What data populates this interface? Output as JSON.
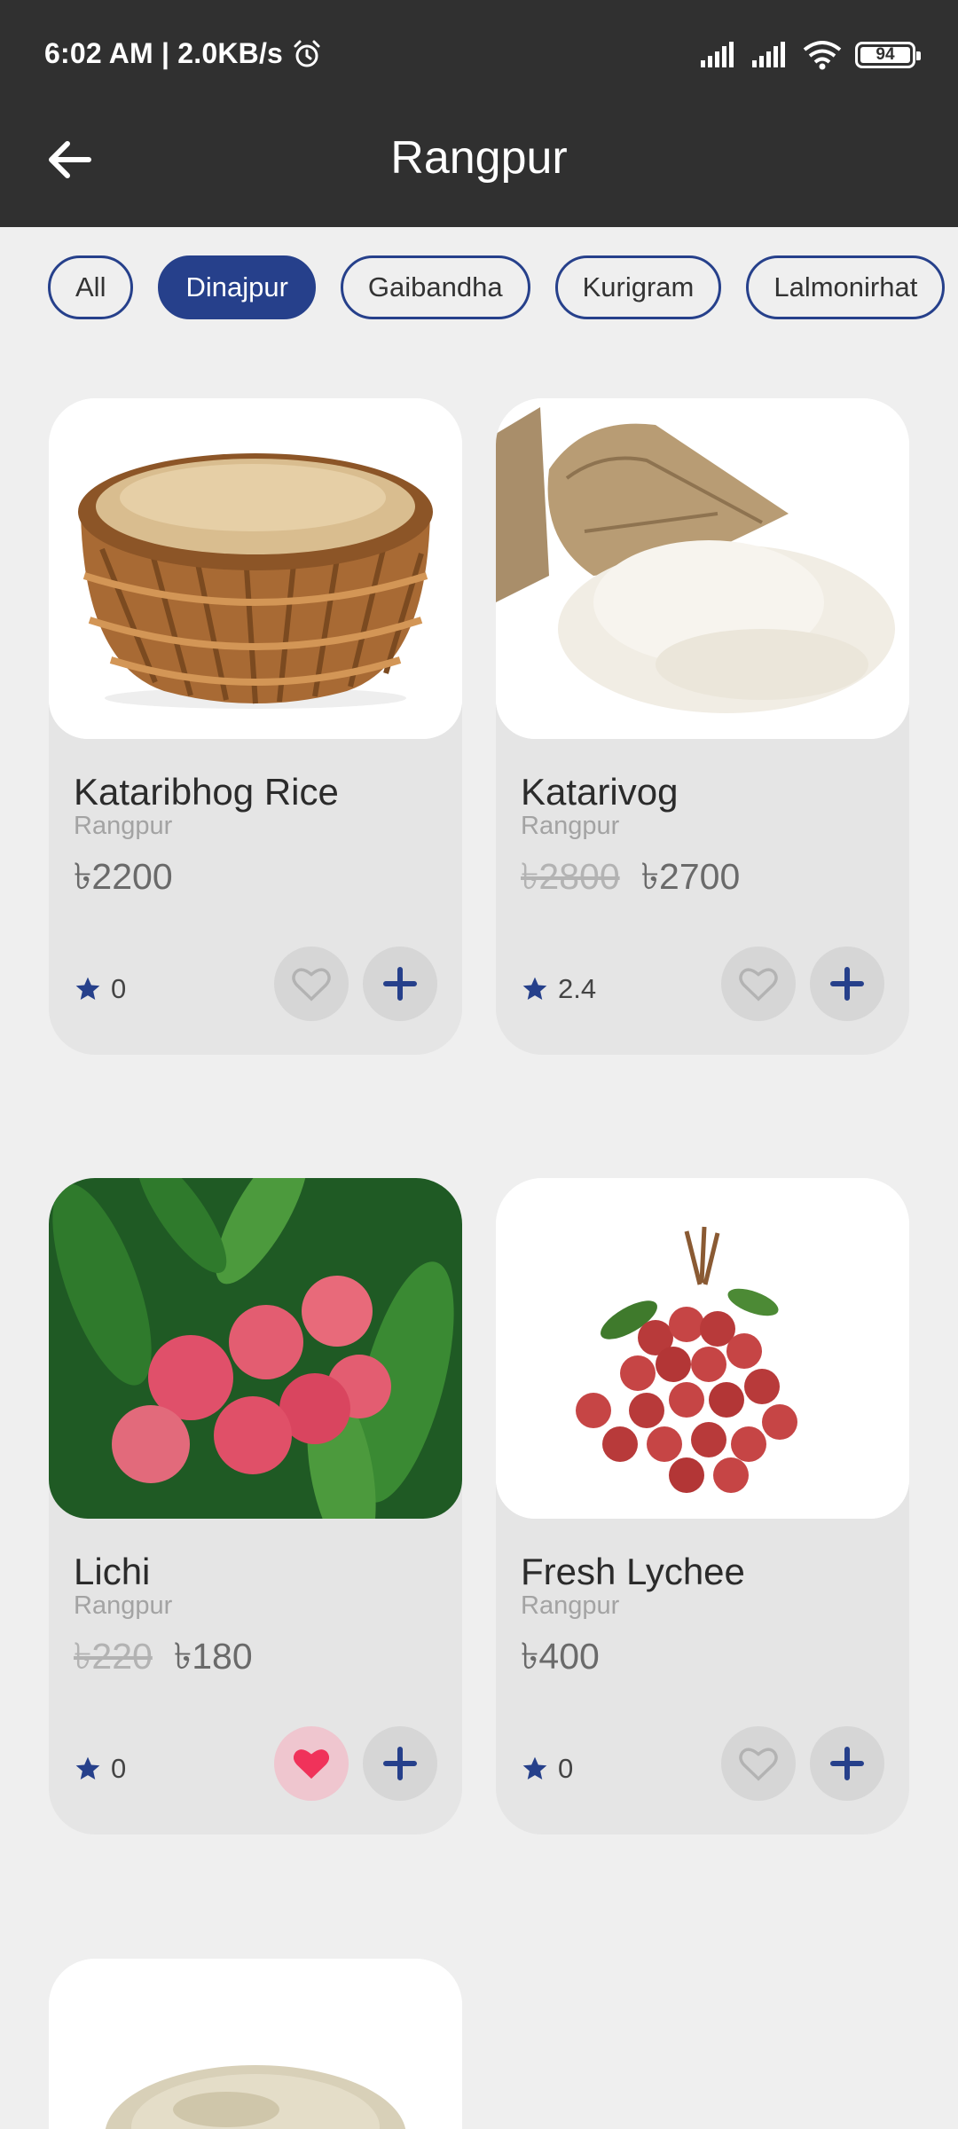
{
  "status_bar": {
    "time_speed": "6:02 AM | 2.0KB/s",
    "battery": "94"
  },
  "app_bar": {
    "title": "Rangpur"
  },
  "filters": [
    {
      "label": "All",
      "active": false
    },
    {
      "label": "Dinajpur",
      "active": true
    },
    {
      "label": "Gaibandha",
      "active": false
    },
    {
      "label": "Kurigram",
      "active": false
    },
    {
      "label": "Lalmonirhat",
      "active": false
    }
  ],
  "products": [
    {
      "name": "Kataribhog Rice",
      "location": "Rangpur",
      "old_price": "",
      "price": "৳2200",
      "rating": "0",
      "favorite": false,
      "image": "rice-basket"
    },
    {
      "name": "Katarivog",
      "location": "Rangpur",
      "old_price": "৳2800",
      "price": "৳2700",
      "rating": "2.4",
      "favorite": false,
      "image": "rice-sack"
    },
    {
      "name": "Lichi",
      "location": "Rangpur",
      "old_price": "৳220",
      "price": "৳180",
      "rating": "0",
      "favorite": true,
      "image": "lychee-tree"
    },
    {
      "name": "Fresh Lychee",
      "location": "Rangpur",
      "old_price": "",
      "price": "৳400",
      "rating": "0",
      "favorite": false,
      "image": "lychee-bunch"
    },
    {
      "name": "",
      "location": "",
      "old_price": "",
      "price": "",
      "rating": "",
      "favorite": false,
      "image": "rice-grains"
    }
  ],
  "colors": {
    "accent": "#26408b",
    "header_bg": "#303030",
    "heart_active": "#f0325a"
  }
}
